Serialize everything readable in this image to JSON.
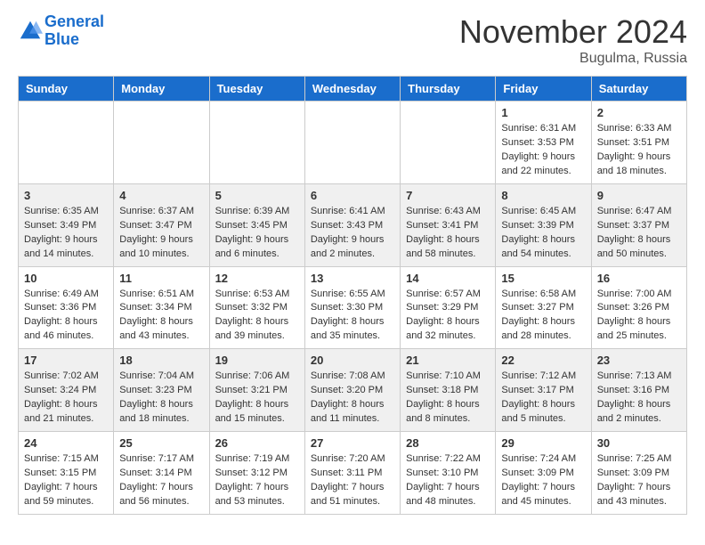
{
  "logo": {
    "line1": "General",
    "line2": "Blue"
  },
  "title": "November 2024",
  "location": "Bugulma, Russia",
  "headers": [
    "Sunday",
    "Monday",
    "Tuesday",
    "Wednesday",
    "Thursday",
    "Friday",
    "Saturday"
  ],
  "weeks": [
    [
      {
        "day": "",
        "info": ""
      },
      {
        "day": "",
        "info": ""
      },
      {
        "day": "",
        "info": ""
      },
      {
        "day": "",
        "info": ""
      },
      {
        "day": "",
        "info": ""
      },
      {
        "day": "1",
        "info": "Sunrise: 6:31 AM\nSunset: 3:53 PM\nDaylight: 9 hours\nand 22 minutes."
      },
      {
        "day": "2",
        "info": "Sunrise: 6:33 AM\nSunset: 3:51 PM\nDaylight: 9 hours\nand 18 minutes."
      }
    ],
    [
      {
        "day": "3",
        "info": "Sunrise: 6:35 AM\nSunset: 3:49 PM\nDaylight: 9 hours\nand 14 minutes."
      },
      {
        "day": "4",
        "info": "Sunrise: 6:37 AM\nSunset: 3:47 PM\nDaylight: 9 hours\nand 10 minutes."
      },
      {
        "day": "5",
        "info": "Sunrise: 6:39 AM\nSunset: 3:45 PM\nDaylight: 9 hours\nand 6 minutes."
      },
      {
        "day": "6",
        "info": "Sunrise: 6:41 AM\nSunset: 3:43 PM\nDaylight: 9 hours\nand 2 minutes."
      },
      {
        "day": "7",
        "info": "Sunrise: 6:43 AM\nSunset: 3:41 PM\nDaylight: 8 hours\nand 58 minutes."
      },
      {
        "day": "8",
        "info": "Sunrise: 6:45 AM\nSunset: 3:39 PM\nDaylight: 8 hours\nand 54 minutes."
      },
      {
        "day": "9",
        "info": "Sunrise: 6:47 AM\nSunset: 3:37 PM\nDaylight: 8 hours\nand 50 minutes."
      }
    ],
    [
      {
        "day": "10",
        "info": "Sunrise: 6:49 AM\nSunset: 3:36 PM\nDaylight: 8 hours\nand 46 minutes."
      },
      {
        "day": "11",
        "info": "Sunrise: 6:51 AM\nSunset: 3:34 PM\nDaylight: 8 hours\nand 43 minutes."
      },
      {
        "day": "12",
        "info": "Sunrise: 6:53 AM\nSunset: 3:32 PM\nDaylight: 8 hours\nand 39 minutes."
      },
      {
        "day": "13",
        "info": "Sunrise: 6:55 AM\nSunset: 3:30 PM\nDaylight: 8 hours\nand 35 minutes."
      },
      {
        "day": "14",
        "info": "Sunrise: 6:57 AM\nSunset: 3:29 PM\nDaylight: 8 hours\nand 32 minutes."
      },
      {
        "day": "15",
        "info": "Sunrise: 6:58 AM\nSunset: 3:27 PM\nDaylight: 8 hours\nand 28 minutes."
      },
      {
        "day": "16",
        "info": "Sunrise: 7:00 AM\nSunset: 3:26 PM\nDaylight: 8 hours\nand 25 minutes."
      }
    ],
    [
      {
        "day": "17",
        "info": "Sunrise: 7:02 AM\nSunset: 3:24 PM\nDaylight: 8 hours\nand 21 minutes."
      },
      {
        "day": "18",
        "info": "Sunrise: 7:04 AM\nSunset: 3:23 PM\nDaylight: 8 hours\nand 18 minutes."
      },
      {
        "day": "19",
        "info": "Sunrise: 7:06 AM\nSunset: 3:21 PM\nDaylight: 8 hours\nand 15 minutes."
      },
      {
        "day": "20",
        "info": "Sunrise: 7:08 AM\nSunset: 3:20 PM\nDaylight: 8 hours\nand 11 minutes."
      },
      {
        "day": "21",
        "info": "Sunrise: 7:10 AM\nSunset: 3:18 PM\nDaylight: 8 hours\nand 8 minutes."
      },
      {
        "day": "22",
        "info": "Sunrise: 7:12 AM\nSunset: 3:17 PM\nDaylight: 8 hours\nand 5 minutes."
      },
      {
        "day": "23",
        "info": "Sunrise: 7:13 AM\nSunset: 3:16 PM\nDaylight: 8 hours\nand 2 minutes."
      }
    ],
    [
      {
        "day": "24",
        "info": "Sunrise: 7:15 AM\nSunset: 3:15 PM\nDaylight: 7 hours\nand 59 minutes."
      },
      {
        "day": "25",
        "info": "Sunrise: 7:17 AM\nSunset: 3:14 PM\nDaylight: 7 hours\nand 56 minutes."
      },
      {
        "day": "26",
        "info": "Sunrise: 7:19 AM\nSunset: 3:12 PM\nDaylight: 7 hours\nand 53 minutes."
      },
      {
        "day": "27",
        "info": "Sunrise: 7:20 AM\nSunset: 3:11 PM\nDaylight: 7 hours\nand 51 minutes."
      },
      {
        "day": "28",
        "info": "Sunrise: 7:22 AM\nSunset: 3:10 PM\nDaylight: 7 hours\nand 48 minutes."
      },
      {
        "day": "29",
        "info": "Sunrise: 7:24 AM\nSunset: 3:09 PM\nDaylight: 7 hours\nand 45 minutes."
      },
      {
        "day": "30",
        "info": "Sunrise: 7:25 AM\nSunset: 3:09 PM\nDaylight: 7 hours\nand 43 minutes."
      }
    ]
  ]
}
